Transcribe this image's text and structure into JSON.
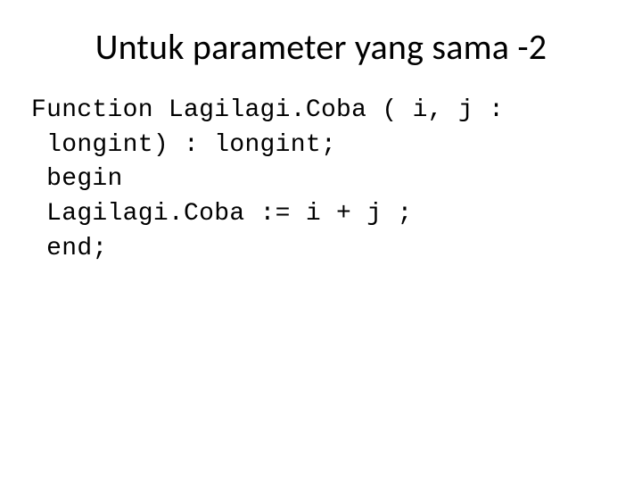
{
  "slide": {
    "title": "Untuk parameter yang sama -2",
    "code": {
      "line1": "Function Lagilagi.Coba ( i, j :",
      "line2": " longint) : longint;",
      "line3": " begin",
      "line4": " Lagilagi.Coba := i + j ;",
      "line5": " end;"
    }
  }
}
